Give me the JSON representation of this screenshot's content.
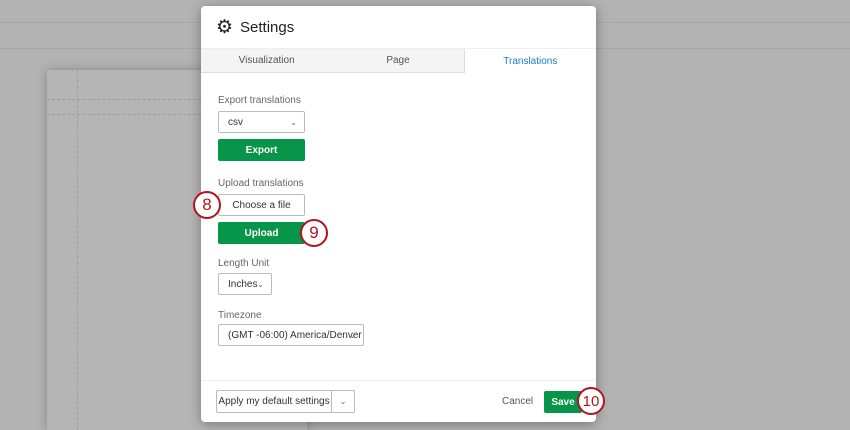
{
  "modal": {
    "title": "Settings",
    "icon": "gear-icon",
    "tabs": [
      {
        "label": "Visualization"
      },
      {
        "label": "Page"
      },
      {
        "label": "Translations"
      }
    ],
    "export": {
      "label": "Export translations",
      "format": "csv",
      "button": "Export"
    },
    "upload": {
      "label": "Upload translations",
      "choose": "Choose a file",
      "button": "Upload"
    },
    "length_unit": {
      "label": "Length Unit",
      "value": "Inches"
    },
    "timezone": {
      "label": "Timezone",
      "value": "(GMT -06:00) America/Denver"
    },
    "footer": {
      "apply": "Apply my default settings",
      "cancel": "Cancel",
      "save": "Save"
    }
  },
  "annotations": [
    "8",
    "9",
    "10"
  ],
  "colors": {
    "accent": "#07954a",
    "tab_active": "#1b7cc9",
    "marker": "#b3141e"
  }
}
